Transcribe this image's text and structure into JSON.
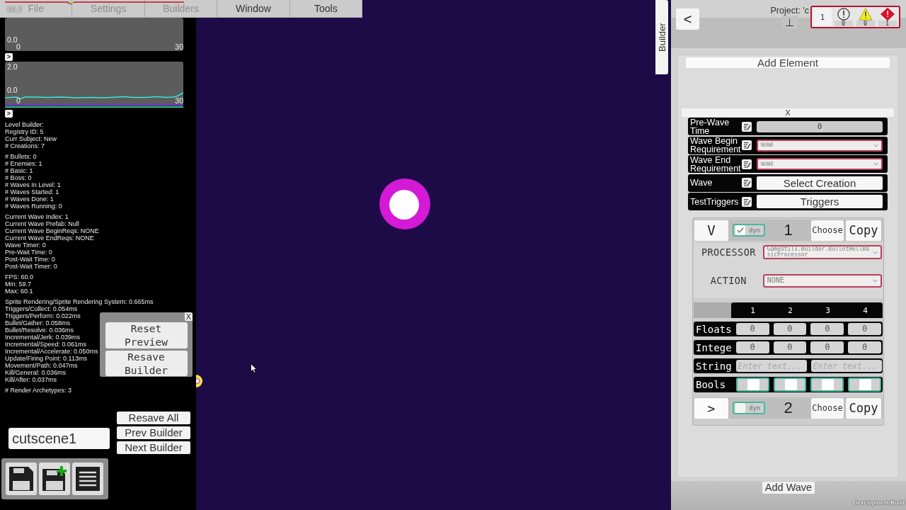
{
  "menu_bar": {
    "fps": "60.2",
    "items": [
      {
        "label": "File",
        "disabled": true
      },
      {
        "label": "Settings",
        "disabled": true
      },
      {
        "label": "Builders",
        "disabled": true
      },
      {
        "label": "Window",
        "disabled": false
      },
      {
        "label": "Tools",
        "disabled": false
      }
    ]
  },
  "graphs": [
    {
      "y_min": "0.0",
      "x_min": "0",
      "x_max": "30",
      "toggle": ">"
    },
    {
      "y_max": "2.0",
      "y_min": "0.0",
      "x_min": "0",
      "x_max": "30",
      "toggle": ">"
    }
  ],
  "debug_info": {
    "groups": [
      [
        "Level Builder:",
        "Registry ID: 5",
        "Curr Subject: New",
        "# Creations: 7"
      ],
      [
        "# Bullets: 0",
        "# Enemies: 1",
        "# Basic: 1",
        "# Boss: 0",
        "# Waves In Level: 1",
        "# Waves Started: 1",
        "# Waves Done: 1",
        "# Waves Running: 0"
      ],
      [
        "Current Wave Index: 1",
        "Current Wave Prefab: Null",
        "Current Wave BeginReqs: NONE",
        "Current Wave EndReqs: NONE",
        "Wave Timer: 0",
        "Pre-Wait Time: 0",
        "Post-Wait Time: 0",
        "Post-Wait Timer: 0"
      ],
      [
        "FPS: 60.0",
        "Min: 59.7",
        "Max: 60.1"
      ],
      [
        "Sprite Rendering/Sprite Rendering System: 0.665ms",
        "Triggers/Collect: 0.054ms",
        "Triggers/Perform: 0.022ms",
        "Bullet/Gather: 0.058ms",
        "Bullet/Resolve: 0.036ms",
        "Incremental/Jerk: 0.039ms",
        "Incremental/Speed: 0.061ms",
        "Incremental/Accelerate: 0.050ms",
        "Update/Firing Point: 0.113ms",
        "Movement/Path: 0.047ms",
        "Kill/General: 0.036ms",
        "Kill/After: 0.037ms"
      ],
      [
        "# Render Archetypes: 3"
      ]
    ]
  },
  "preview_popup": {
    "close": "X",
    "buttons": [
      "Reset Preview",
      "Resave Builder"
    ]
  },
  "builder_name_field": {
    "value": "cutscene1"
  },
  "builder_buttons": [
    "Resave All",
    "Prev Builder",
    "Next Builder"
  ],
  "toolbar": {
    "buttons": [
      {
        "kind": "save"
      },
      {
        "kind": "save_new"
      },
      {
        "kind": "list"
      }
    ]
  },
  "side_tab": {
    "label": "Builder"
  },
  "inspector": {
    "back": "<",
    "project": "Project: 'c",
    "pin": "⊥",
    "console": {
      "log_count": "1",
      "info_count": "0",
      "warning_count": "0",
      "error_count": "1"
    },
    "add_element": "Add Element",
    "remove": "X",
    "properties": [
      {
        "label": "Pre-Wave Time",
        "kind": "number",
        "value": "0"
      },
      {
        "label": "Wave Begin Requirement",
        "kind": "dropdown",
        "value": "NONE"
      },
      {
        "label": "Wave End Requirement",
        "kind": "dropdown",
        "value": "NONE"
      },
      {
        "label": "Wave",
        "kind": "button",
        "value": "Select Creation"
      },
      {
        "label": "TestTriggers",
        "kind": "button",
        "value": "Triggers"
      }
    ],
    "elements": [
      {
        "toggle": "V",
        "expanded": true,
        "dyn": {
          "label": "dyn",
          "checked": true
        },
        "index": "1",
        "choose": "Choose",
        "copy": "Copy",
        "processor": {
          "label": "PROCESSOR",
          "value": "GameUtils.Builder.BulletHellBasicProcessor"
        },
        "action": {
          "label": "ACTION",
          "value": "NONE"
        },
        "params": {
          "columns": [
            "1",
            "2",
            "3",
            "4"
          ],
          "rows": [
            {
              "label": "Floats",
              "kind": "number",
              "values": [
                "0",
                "0",
                "0",
                "0"
              ]
            },
            {
              "label": "Intege",
              "kind": "number",
              "values": [
                "0",
                "0",
                "0",
                "0"
              ]
            },
            {
              "label": "String",
              "kind": "text",
              "placeholders": [
                "Enter text...",
                "Enter text..."
              ]
            },
            {
              "label": "Bools",
              "kind": "toggle",
              "toggles": [
                {
                  "on": false
                },
                {
                  "on": false
                },
                {
                  "on": false
                },
                {
                  "on": false
                }
              ]
            }
          ]
        }
      },
      {
        "toggle": ">",
        "expanded": false,
        "dyn": {
          "label": "dyn",
          "checked": false
        },
        "index": "2",
        "choose": "Choose",
        "copy": "Copy"
      }
    ],
    "add_wave": "Add Wave"
  },
  "footer": {
    "label": "Development Build"
  }
}
